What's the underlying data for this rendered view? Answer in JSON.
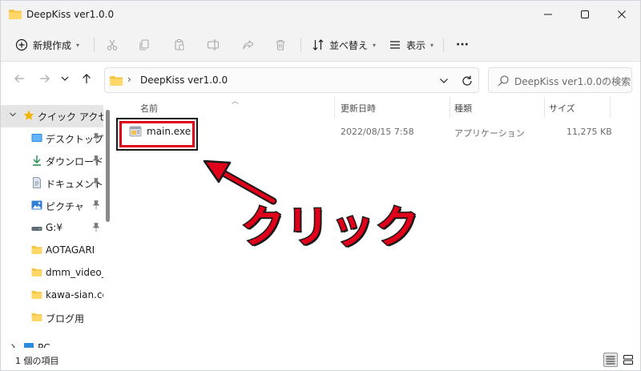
{
  "window": {
    "title": "DeepKiss ver1.0.0",
    "controls": [
      "minimize-icon",
      "maximize-icon",
      "close-icon"
    ]
  },
  "toolbar": {
    "new_label": "新規作成",
    "sort_label": "並べ替え",
    "view_label": "表示",
    "more_label": "···",
    "icons": [
      "cut-icon",
      "copy-icon",
      "paste-icon",
      "rename-icon",
      "share-icon",
      "delete-icon"
    ]
  },
  "address": {
    "path": "DeepKiss ver1.0.0",
    "chevron": "›",
    "search_placeholder": "DeepKiss ver1.0.0の検索"
  },
  "sidebar": {
    "quick_access": "クイック アクセス",
    "items": [
      {
        "label": "デスクトップ",
        "icon": "desktop-icon",
        "pinned": true
      },
      {
        "label": "ダウンロード",
        "icon": "download-icon",
        "pinned": true
      },
      {
        "label": "ドキュメント",
        "icon": "document-icon",
        "pinned": true
      },
      {
        "label": "ピクチャ",
        "icon": "pictures-icon",
        "pinned": true
      },
      {
        "label": "G:¥",
        "icon": "drive-icon",
        "pinned": true
      },
      {
        "label": "AOTAGARI",
        "icon": "folder-icon",
        "pinned": false
      },
      {
        "label": "dmm_video_da",
        "icon": "folder-icon",
        "pinned": false
      },
      {
        "label": "kawa-sian.com",
        "icon": "folder-icon",
        "pinned": false
      },
      {
        "label": "ブログ用",
        "icon": "folder-icon",
        "pinned": false
      }
    ],
    "pc_label": "PC"
  },
  "columns": {
    "name": "名前",
    "date": "更新日時",
    "type": "種類",
    "size": "サイズ"
  },
  "files": [
    {
      "name": "main.exe",
      "date": "2022/08/15 7:58",
      "type": "アプリケーション",
      "size": "11,275 KB",
      "icon": "exe-icon"
    }
  ],
  "annotation": {
    "text": "クリック",
    "color": "#e0001a"
  },
  "status": {
    "count": "1 個の項目"
  }
}
